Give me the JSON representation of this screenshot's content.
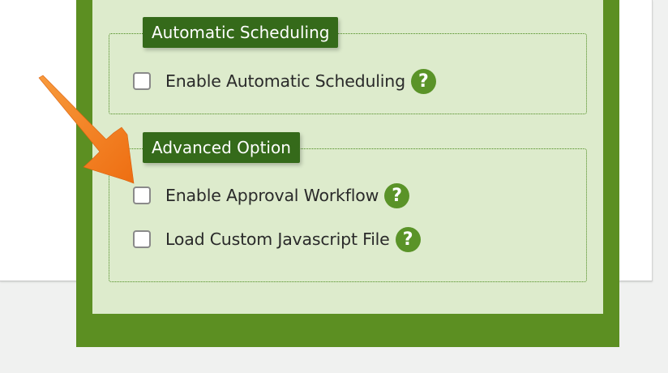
{
  "colors": {
    "accent": "#5c8f22",
    "panel_bg": "#ddebcc",
    "legend_bg": "#356a1a",
    "arrow": "#f5821e"
  },
  "automatic_scheduling": {
    "legend": "Automatic Scheduling",
    "options": [
      {
        "label": "Enable Automatic Scheduling",
        "checked": false,
        "help_icon": "?"
      }
    ]
  },
  "advanced_option": {
    "legend": "Advanced Option",
    "options": [
      {
        "label": "Enable Approval Workflow",
        "checked": false,
        "help_icon": "?"
      },
      {
        "label": "Load Custom Javascript File",
        "checked": false,
        "help_icon": "?"
      }
    ]
  },
  "annotation": {
    "icon": "orange-arrow-icon",
    "points_to": "Enable Approval Workflow"
  }
}
